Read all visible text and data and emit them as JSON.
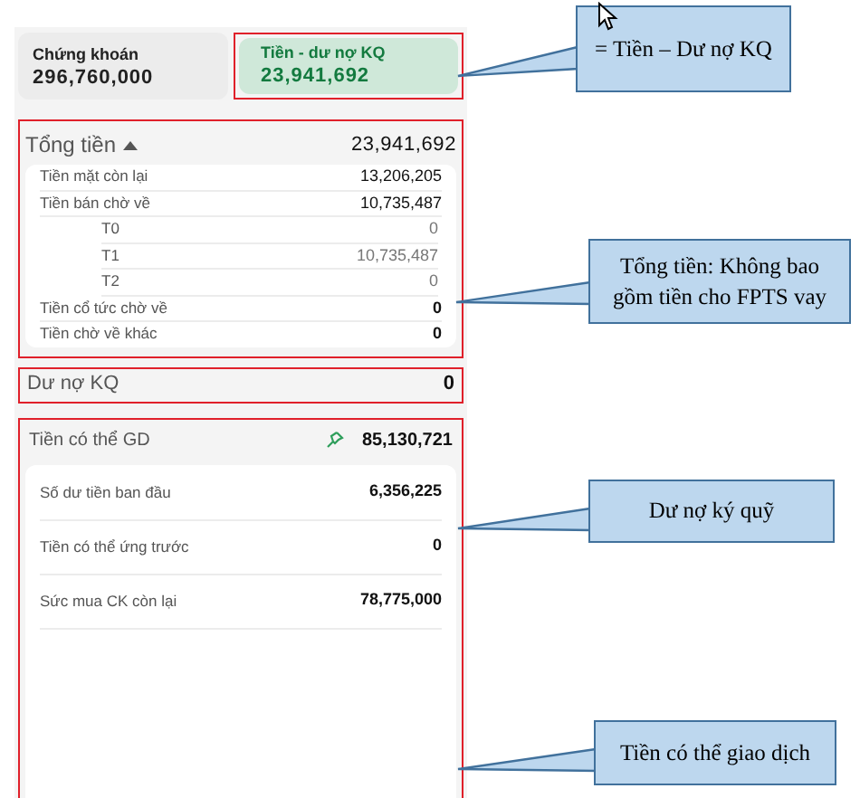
{
  "summary": {
    "securities": {
      "label": "Chứng khoán",
      "value": "296,760,000"
    },
    "cash_minus_debt": {
      "label": "Tiền - dư nợ KQ",
      "value": "23,941,692",
      "selected": true
    }
  },
  "total_cash": {
    "label": "Tổng tiền",
    "value": "23,941,692",
    "expanded": true,
    "rows": [
      {
        "label": "Tiền mặt còn lại",
        "value": "13,206,205"
      },
      {
        "label": "Tiền bán chờ về",
        "value": "10,735,487",
        "children": [
          {
            "label": "T0",
            "value": "0"
          },
          {
            "label": "T1",
            "value": "10,735,487"
          },
          {
            "label": "T2",
            "value": "0"
          }
        ]
      },
      {
        "label": "Tiền cổ tức chờ về",
        "value": "0"
      },
      {
        "label": "Tiền chờ về khác",
        "value": "0"
      }
    ]
  },
  "margin_debt": {
    "label": "Dư nợ KQ",
    "value": "0"
  },
  "tradable_cash": {
    "label": "Tiền có thể GD",
    "value": "85,130,721",
    "rows": [
      {
        "label": "Số dư tiền ban đầu",
        "value": "6,356,225"
      },
      {
        "label": "Tiền có thể ứng trước",
        "value": "0"
      },
      {
        "label": "Sức mua CK còn lại",
        "value": "78,775,000"
      }
    ]
  },
  "callouts": [
    {
      "text": "= Tiền – Dư nợ KQ"
    },
    {
      "text": "Tổng tiền: Không bao gồm tiền cho FPTS vay"
    },
    {
      "text": "Dư nợ ký quỹ"
    },
    {
      "text": "Tiền có thể giao dịch"
    }
  ]
}
